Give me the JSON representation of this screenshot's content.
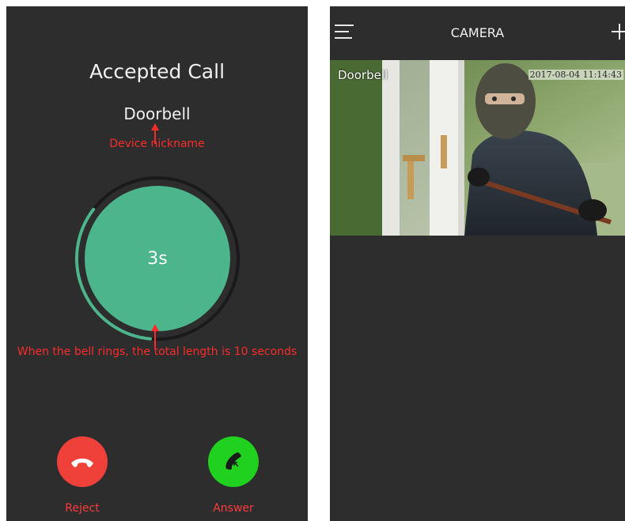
{
  "call_screen": {
    "title": "Accepted Call",
    "device_name": "Doorbell",
    "nickname_annotation": "Device nickname",
    "timer_text": "3s",
    "ring_annotation": "When the bell rings, the total length is 10 seconds",
    "reject_label": "Reject",
    "answer_label": "Answer",
    "timer_progress_fraction": 0.3
  },
  "camera_screen": {
    "title": "CAMERA",
    "feed_name": "Doorbell",
    "feed_timestamp": "2017-08-04 11:14:43"
  },
  "colors": {
    "background": "#2d2d2d",
    "accent_green": "#4db58c",
    "reject_red": "#f0403a",
    "answer_green": "#21d11f",
    "annotation_red": "#ff2b2b"
  },
  "icons": {
    "reject": "phone-hangup-icon",
    "answer": "phone-answer-icon",
    "menu": "menu-icon",
    "add": "plus-icon"
  }
}
